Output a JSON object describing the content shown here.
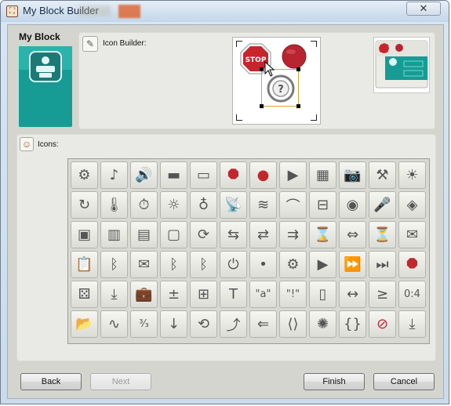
{
  "window": {
    "title": "My Block Builder",
    "close_glyph": "✕"
  },
  "my_block": {
    "label": "My Block"
  },
  "icon_builder": {
    "label": "Icon Builder:",
    "stop_text": "STOP"
  },
  "icons_section": {
    "label": "Icons:"
  },
  "icons": [
    {
      "name": "gear-icon",
      "glyph": "⚙"
    },
    {
      "name": "music-note-icon",
      "glyph": "♪"
    },
    {
      "name": "speaker-icon",
      "glyph": "🔊"
    },
    {
      "name": "flashlight-icon",
      "glyph": "▬"
    },
    {
      "name": "display-icon",
      "glyph": "▭"
    },
    {
      "name": "stop-sign-icon",
      "glyph": "⯃",
      "color": "#c4262e"
    },
    {
      "name": "record-icon",
      "glyph": "●",
      "color": "#c4262e"
    },
    {
      "name": "play-icon",
      "glyph": "▶"
    },
    {
      "name": "nxt-brick-icon",
      "glyph": "▦"
    },
    {
      "name": "camera-icon",
      "glyph": "📷"
    },
    {
      "name": "motor-icon",
      "glyph": "⚒"
    },
    {
      "name": "light-sun-icon",
      "glyph": "☀"
    },
    {
      "name": "rotation-sensor-icon",
      "glyph": "↻"
    },
    {
      "name": "thermometer-icon",
      "glyph": "🌡"
    },
    {
      "name": "timer-icon",
      "glyph": "⏱"
    },
    {
      "name": "sensor-light-icon",
      "glyph": "☼"
    },
    {
      "name": "stethoscope-icon",
      "glyph": "♁"
    },
    {
      "name": "antenna-icon",
      "glyph": "📡"
    },
    {
      "name": "sound-wave-icon",
      "glyph": "≋"
    },
    {
      "name": "satellite-dish-icon",
      "glyph": "⌒"
    },
    {
      "name": "ultrasonic-icon",
      "glyph": "⊟"
    },
    {
      "name": "compass-icon",
      "glyph": "◉"
    },
    {
      "name": "microphone-icon",
      "glyph": "🎤"
    },
    {
      "name": "eye-icon",
      "glyph": "◈"
    },
    {
      "name": "data-block-icon",
      "glyph": "▣"
    },
    {
      "name": "battery-icon",
      "glyph": "▥"
    },
    {
      "name": "box-icon",
      "glyph": "▤"
    },
    {
      "name": "file-icon",
      "glyph": "▢"
    },
    {
      "name": "loop-icon",
      "glyph": "⟳"
    },
    {
      "name": "split-arrows-icon",
      "glyph": "⇆"
    },
    {
      "name": "random-icon",
      "glyph": "⇄"
    },
    {
      "name": "number-switch-icon",
      "glyph": "⇉"
    },
    {
      "name": "hourglass-small-icon",
      "glyph": "⌛"
    },
    {
      "name": "range-icon",
      "glyph": "⇔"
    },
    {
      "name": "hourglass-icon",
      "glyph": "⏳"
    },
    {
      "name": "send-message-icon",
      "glyph": "✉"
    },
    {
      "name": "clipboard-icon",
      "glyph": "📋"
    },
    {
      "name": "bluetooth-icon",
      "glyph": "ᛒ"
    },
    {
      "name": "envelope-icon",
      "glyph": "✉"
    },
    {
      "name": "bluetooth-send-icon",
      "glyph": "ᛒ"
    },
    {
      "name": "bluetooth-receive-icon",
      "glyph": "ᛒ"
    },
    {
      "name": "power-icon",
      "glyph": "⏻"
    },
    {
      "name": "dot-icon",
      "glyph": "•"
    },
    {
      "name": "gears-icon",
      "glyph": "⚙"
    },
    {
      "name": "play-gear-icon",
      "glyph": "▶"
    },
    {
      "name": "forward-gear-icon",
      "glyph": "⏩"
    },
    {
      "name": "fast-forward-gear-icon",
      "glyph": "⏭"
    },
    {
      "name": "stop-gear-icon",
      "glyph": "⯃",
      "color": "#c4262e"
    },
    {
      "name": "dice-icon",
      "glyph": "⚄"
    },
    {
      "name": "download-arrow-icon",
      "glyph": "⤓"
    },
    {
      "name": "briefcase-icon",
      "glyph": "💼"
    },
    {
      "name": "math-icon",
      "glyph": "±"
    },
    {
      "name": "calculator-icon",
      "glyph": "⊞"
    },
    {
      "name": "text-icon",
      "glyph": "T"
    },
    {
      "name": "quote-a-icon",
      "glyph": "\"a\""
    },
    {
      "name": "quote-bang-icon",
      "glyph": "\"!\""
    },
    {
      "name": "spool-icon",
      "glyph": "▯"
    },
    {
      "name": "width-arrows-icon",
      "glyph": "↔"
    },
    {
      "name": "compare-icon",
      "glyph": "≥"
    },
    {
      "name": "counter-icon",
      "glyph": "0:4"
    },
    {
      "name": "folder-icon",
      "glyph": "📂"
    },
    {
      "name": "waveform-icon",
      "glyph": "∿"
    },
    {
      "name": "number-convert-icon",
      "glyph": "³⁄₃"
    },
    {
      "name": "down-arrow-icon",
      "glyph": "↓"
    },
    {
      "name": "refresh-icon",
      "glyph": "⟲"
    },
    {
      "name": "branch-icon",
      "glyph": "⤴"
    },
    {
      "name": "back-arrow-icon",
      "glyph": "⇐"
    },
    {
      "name": "left-right-icon",
      "glyph": "⟨⟩"
    },
    {
      "name": "rotate-dial-icon",
      "glyph": "✺"
    },
    {
      "name": "brace-icon",
      "glyph": "{}"
    },
    {
      "name": "no-sign-icon",
      "glyph": "⊘",
      "color": "#c4262e"
    },
    {
      "name": "download-icon",
      "glyph": "⤓"
    }
  ],
  "buttons": {
    "back": "Back",
    "next": "Next",
    "finish": "Finish",
    "cancel": "Cancel"
  }
}
